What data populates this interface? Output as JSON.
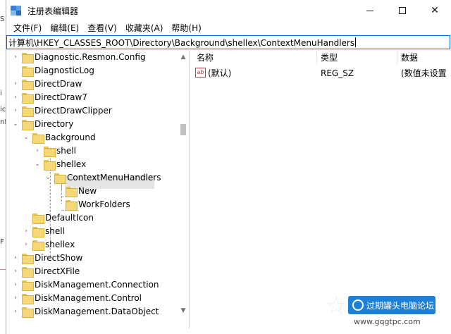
{
  "window": {
    "title": "注册表编辑器",
    "controls": {
      "minimize": "—",
      "maximize": "☐",
      "close": "✕"
    }
  },
  "menu": [
    "文件(F)",
    "编辑(E)",
    "查看(V)",
    "收藏夹(A)",
    "帮助(H)"
  ],
  "address": "计算机\\HKEY_CLASSES_ROOT\\Directory\\Background\\shellex\\ContextMenuHandlers",
  "tree": {
    "items": [
      {
        "label": "Diagnostic.Resmon.Config",
        "expanded": false
      },
      {
        "label": "DiagnosticLog",
        "expanded": false
      },
      {
        "label": "DirectDraw",
        "expanded": false
      },
      {
        "label": "DirectDraw7",
        "expanded": false
      },
      {
        "label": "DirectDrawClipper",
        "expanded": false
      },
      {
        "label": "Directory",
        "expanded": true
      },
      {
        "label": "Background",
        "expanded": true
      },
      {
        "label": "shell",
        "expanded": false
      },
      {
        "label": "shellex",
        "expanded": true
      },
      {
        "label": "ContextMenuHandlers",
        "expanded": true,
        "selected": true
      },
      {
        "label": "New",
        "expanded": false
      },
      {
        "label": "WorkFolders",
        "expanded": false
      },
      {
        "label": "DefaultIcon",
        "expanded": false
      },
      {
        "label": "shell",
        "expanded": false
      },
      {
        "label": "shellex",
        "expanded": false
      },
      {
        "label": "DirectShow",
        "expanded": false
      },
      {
        "label": "DirectXFile",
        "expanded": false
      },
      {
        "label": "DiskManagement.Connection",
        "expanded": false
      },
      {
        "label": "DiskManagement.Control",
        "expanded": false
      },
      {
        "label": "DiskManagement.DataObject",
        "expanded": false
      }
    ]
  },
  "list": {
    "columns": {
      "name": "名称",
      "type": "类型",
      "data": "数据"
    },
    "rows": [
      {
        "icon": "ab",
        "name": "(默认)",
        "type": "REG_SZ",
        "data": "(数值未设置"
      }
    ]
  },
  "watermark": {
    "text": "过期罐头电脑论坛",
    "url": "www.gqgtpc.com"
  },
  "background_window": {
    "glyphs": [
      "S",
      "i",
      "ic",
      "nf"
    ],
    "bottom_glyph": "F"
  }
}
